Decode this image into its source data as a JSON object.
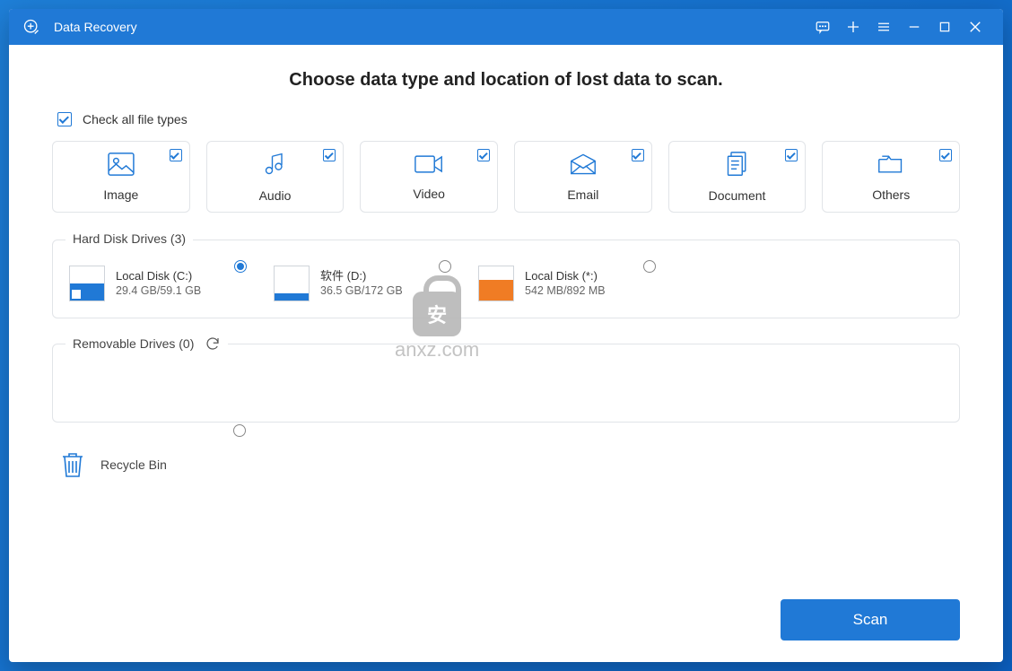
{
  "titlebar": {
    "title": "Data Recovery"
  },
  "heading": "Choose data type and location of lost data to scan.",
  "check_all_label": "Check all file types",
  "types": [
    {
      "key": "image",
      "label": "Image",
      "checked": true
    },
    {
      "key": "audio",
      "label": "Audio",
      "checked": true
    },
    {
      "key": "video",
      "label": "Video",
      "checked": true
    },
    {
      "key": "email",
      "label": "Email",
      "checked": true
    },
    {
      "key": "document",
      "label": "Document",
      "checked": true
    },
    {
      "key": "others",
      "label": "Others",
      "checked": true
    }
  ],
  "hdd": {
    "legend": "Hard Disk Drives (3)",
    "drives": [
      {
        "name": "Local Disk (C:)",
        "size": "29.4 GB/59.1 GB",
        "fill_pct": 50,
        "selected": true,
        "windows": true,
        "color": "blue"
      },
      {
        "name": "软件 (D:)",
        "size": "36.5 GB/172 GB",
        "fill_pct": 22,
        "selected": false,
        "windows": false,
        "color": "blue"
      },
      {
        "name": "Local Disk (*:)",
        "size": "542 MB/892 MB",
        "fill_pct": 60,
        "selected": false,
        "windows": false,
        "color": "orange"
      }
    ]
  },
  "removable": {
    "legend": "Removable Drives (0)"
  },
  "recycle_bin": {
    "label": "Recycle Bin",
    "selected": false
  },
  "scan_label": "Scan",
  "watermark": "anxz.com"
}
